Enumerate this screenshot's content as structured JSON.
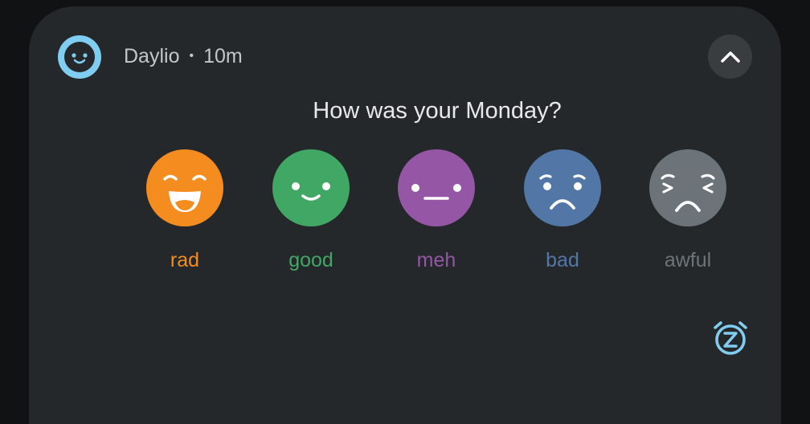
{
  "notification": {
    "app_name": "Daylio",
    "separator": "•",
    "time": "10m",
    "question": "How was your Monday?"
  },
  "moods": [
    {
      "label": "rad",
      "color": "#f58c1f",
      "icon": "rad-face-icon"
    },
    {
      "label": "good",
      "color": "#40a764",
      "icon": "good-face-icon"
    },
    {
      "label": "meh",
      "color": "#9456a5",
      "icon": "meh-face-icon"
    },
    {
      "label": "bad",
      "color": "#5277a7",
      "icon": "bad-face-icon"
    },
    {
      "label": "awful",
      "color": "#6c7479",
      "icon": "awful-face-icon"
    }
  ],
  "colors": {
    "background": "#111213",
    "card": "#25282a",
    "accent": "#7fcdf0"
  },
  "icons": {
    "app": "daylio-app-icon",
    "collapse": "chevron-up-icon",
    "snooze": "snooze-alarm-icon"
  }
}
